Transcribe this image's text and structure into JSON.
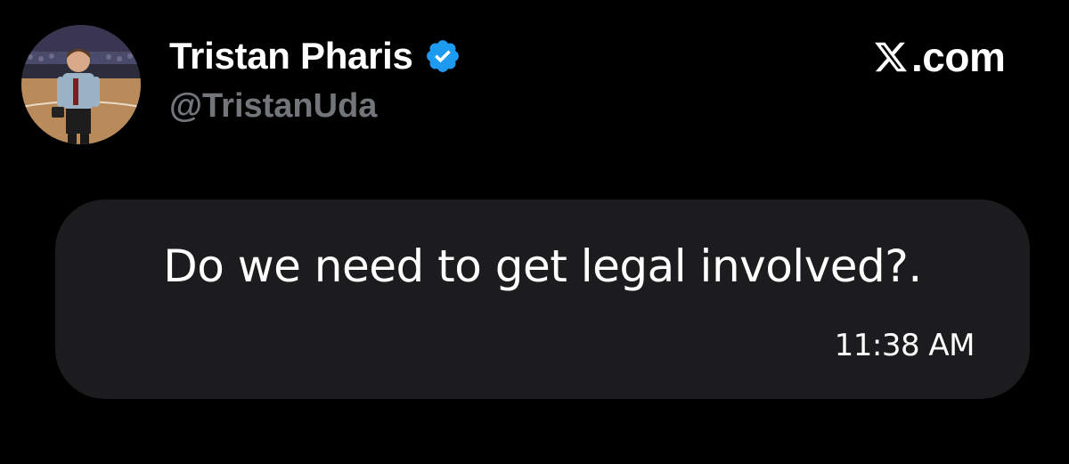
{
  "post": {
    "author": {
      "display_name": "Tristan Pharis",
      "handle": "@TristanUda",
      "verified": true,
      "verified_icon": "verified-badge-icon",
      "avatar": "avatar-photo"
    },
    "brand": {
      "icon": "x-logo-icon",
      "text": ".com"
    }
  },
  "message": {
    "text": "Do we need to get legal involved?.",
    "timestamp": "11:38 AM"
  },
  "colors": {
    "background": "#000000",
    "bubble": "#1c1c1e",
    "handle": "#72767b",
    "verified": "#1d9bf0"
  }
}
